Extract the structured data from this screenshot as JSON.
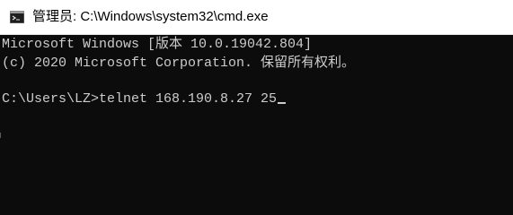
{
  "window": {
    "title": "管理员: C:\\Windows\\system32\\cmd.exe",
    "icon": "cmd-icon"
  },
  "console": {
    "version_line": "Microsoft Windows [版本 10.0.19042.804]",
    "copyright_line": "(c) 2020 Microsoft Corporation. 保留所有权利。",
    "prompt": "C:\\Users\\LZ>",
    "command": "telnet 168.190.8.27 25"
  },
  "colors": {
    "console_background": "#0c0c0c",
    "console_text": "#cccccc",
    "titlebar_background": "#ffffff"
  }
}
